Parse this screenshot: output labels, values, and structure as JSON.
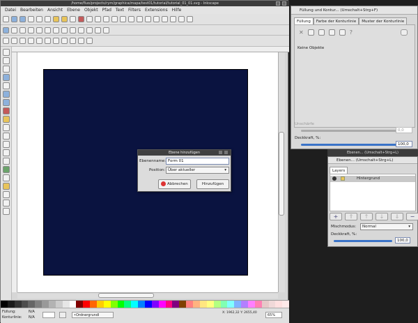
{
  "main_window": {
    "title": "/home/fluo/projects/rym/graphica/mapa/test01/tutorial/tutorial_01_01.svg - Inkscape",
    "menu": [
      "Datei",
      "Bearbeiten",
      "Ansicht",
      "Ebene",
      "Objekt",
      "Pfad",
      "Text",
      "Filters",
      "Extensions",
      "Hilfe"
    ]
  },
  "dialog": {
    "title": "Ebene hinzufügen",
    "name_label": "Ebenenname:",
    "name_value": "Form 01",
    "position_label": "Position:",
    "position_value": "Über aktueller",
    "cancel_label": "Abbrechen",
    "add_label": "Hinzufügen"
  },
  "fill_panel": {
    "title": "Füllung und Kontur... (Umschalt+Strg+F)",
    "tabs": [
      "Füllung",
      "Farbe der Konturlinie",
      "Muster der Konturlinie"
    ],
    "no_objects": "Keine Objekte",
    "blur_label": "Unschärfe",
    "blur_value": "0,0",
    "opacity_label": "Deckkraft, %:",
    "opacity_value": "100,0"
  },
  "layers_panel": {
    "title": "Ebenen... (Umschalt+Strg+L)",
    "tab": "Layers",
    "layer_name": "Hintergrund",
    "blend_label": "Mischmodus:",
    "blend_value": "Normal",
    "opacity_label": "Deckkraft, %:",
    "opacity_value": "100,0"
  },
  "statusbar": {
    "fill_label": "Füllung:",
    "stroke_label": "Konturlinie:",
    "fill_value": "N/A",
    "stroke_value": "N/A",
    "layer_value": "•Ordnergrundl",
    "coords": "X: 1962,32  Y: 2655,40",
    "zoom": "65%"
  },
  "colors": {
    "page": "#0a1340",
    "palette": [
      "#000000",
      "#1a1a1a",
      "#333333",
      "#4d4d4d",
      "#666666",
      "#808080",
      "#999999",
      "#b3b3b3",
      "#cccccc",
      "#e6e6e6",
      "#ffffff",
      "#800000",
      "#ff0000",
      "#ff6600",
      "#ffcc00",
      "#ffff00",
      "#80ff00",
      "#00ff00",
      "#00ff80",
      "#00ffff",
      "#0080ff",
      "#0000ff",
      "#8000ff",
      "#ff00ff",
      "#ff0080",
      "#800080",
      "#804000",
      "#ff8080",
      "#ffb380",
      "#ffe680",
      "#ffff80",
      "#b3ff80",
      "#80ffb3",
      "#80ffff",
      "#80b3ff",
      "#b380ff",
      "#ff80ff",
      "#ff80b3",
      "#e6c8c8",
      "#f0d8d8",
      "#ffe0e0",
      "#ffeaea"
    ]
  }
}
